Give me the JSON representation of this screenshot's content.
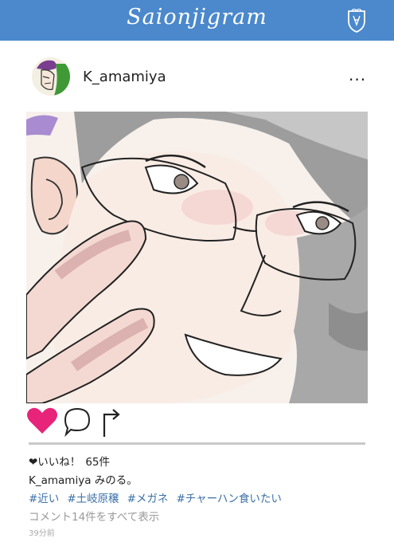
{
  "app": {
    "title": "Saionjigram"
  },
  "post": {
    "username": "K_amamiya",
    "more_label": "...",
    "likes_label": "❤いいね！",
    "likes_count": "65件",
    "caption_user": "K_amamiya",
    "caption_text": "みのる。",
    "hashtags": [
      "#近い",
      "#土岐原穣",
      "#メガネ",
      "#チャーハン食いたい"
    ],
    "comments_link": "コメント14件をすべて表示",
    "timestamp": "39分前"
  },
  "colors": {
    "header": "#4b88cc",
    "like": "#e8237a",
    "hashtag": "#3a6fa6",
    "muted": "#9a9a9a"
  },
  "icons": {
    "like": "heart-icon",
    "comment": "speech-bubble-icon",
    "share": "share-arrow-icon",
    "crest": "crest-icon",
    "more": "more-dots-icon"
  }
}
